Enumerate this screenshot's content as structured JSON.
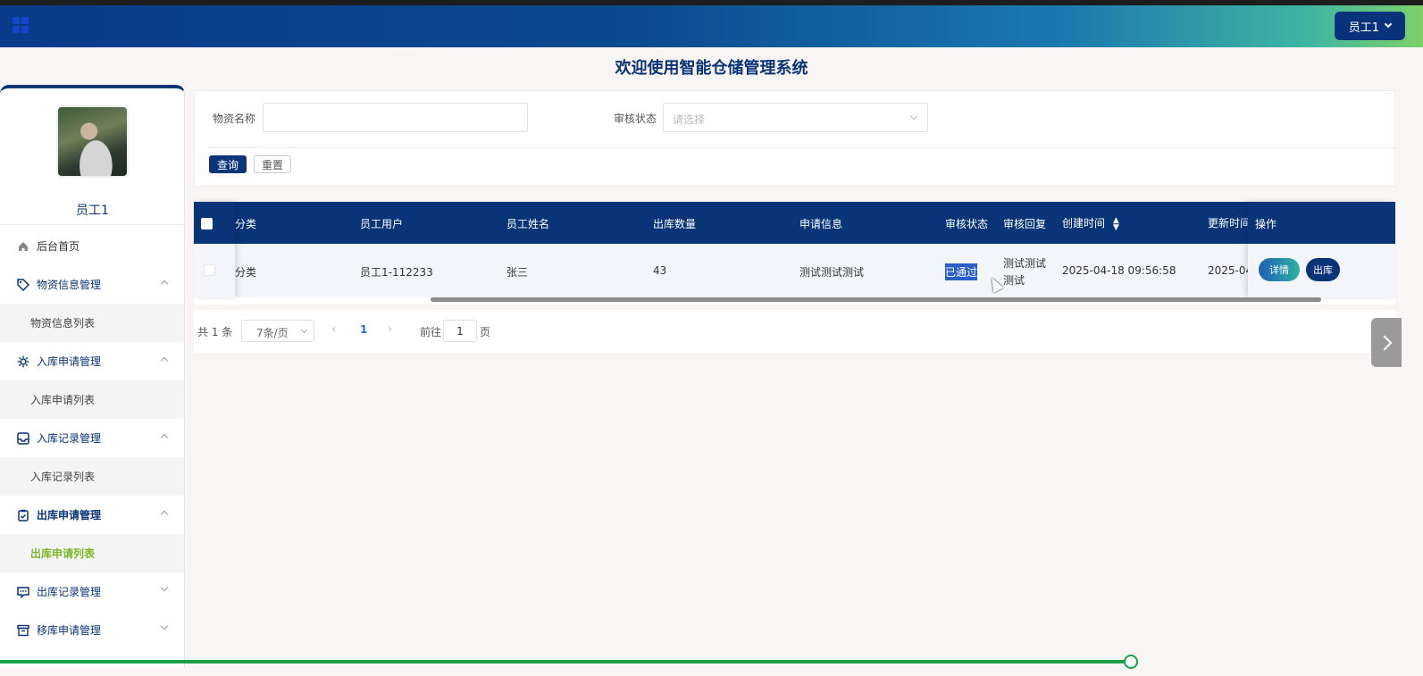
{
  "header": {
    "user_menu_label": "员工1"
  },
  "page": {
    "title": "欢迎使用智能仓储管理系统"
  },
  "profile": {
    "name": "员工1"
  },
  "sidebar": {
    "items": [
      {
        "label": "后台首页",
        "icon": "home-icon"
      },
      {
        "label": "物资信息管理",
        "icon": "tag-icon",
        "sub": "物资信息列表"
      },
      {
        "label": "入库申请管理",
        "icon": "gear-icon",
        "sub": "入库申请列表"
      },
      {
        "label": "入库记录管理",
        "icon": "inbox-icon",
        "sub": "入库记录列表"
      },
      {
        "label": "出库申请管理",
        "icon": "clipboard-icon",
        "sub": "出库申请列表"
      },
      {
        "label": "出库记录管理",
        "icon": "message-icon"
      },
      {
        "label": "移库申请管理",
        "icon": "archive-icon"
      }
    ]
  },
  "search": {
    "name_label": "物资名称",
    "name_value": "",
    "status_label": "审核状态",
    "status_placeholder": "请选择",
    "query_button": "查询",
    "reset_button": "重置"
  },
  "table": {
    "headers": [
      "分类",
      "员工用户",
      "员工姓名",
      "出库数量",
      "申请信息",
      "审核状态",
      "审核回复",
      "创建时间",
      "更新时间",
      "操作"
    ],
    "rows": [
      {
        "category": "分类",
        "user": "员工1-112233",
        "name": "张三",
        "quantity": "43",
        "apply_info": "测试测试测试",
        "status": "已通过",
        "reply_line1": "测试测试",
        "reply_line2": "测试",
        "created": "2025-04-18 09:56:58",
        "updated": "2025-04",
        "detail_button": "详情",
        "out_button": "出库"
      }
    ]
  },
  "pagination": {
    "total": "共 1 条",
    "page_size": "7条/页",
    "current_page": "1",
    "goto_label": "前往",
    "goto_value": "1",
    "goto_suffix": "页"
  }
}
